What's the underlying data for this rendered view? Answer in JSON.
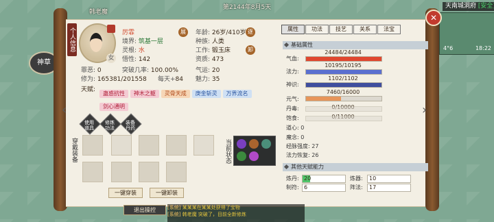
{
  "top": {
    "character_name": "韩老魔",
    "date": "第2144年8月5天",
    "location": "天南城洞府",
    "safe_label": "[安全]",
    "minimap_left": "4°6",
    "minimap_right": "18:22"
  },
  "side_button": "神草",
  "close_label": "✕",
  "left_tab": "个人信息",
  "profile": {
    "name": "厉霏",
    "realm_label": "境界:",
    "realm": "筑基一层",
    "root_label": "灵根:",
    "root": "水",
    "insight_label": "悟性:",
    "insight": "142",
    "age_label": "年龄:",
    "age": "26岁/410岁",
    "race_label": "种族:",
    "race": "人类",
    "job_label": "工作:",
    "job": "锻玉床",
    "aptitude_label": "资质:",
    "aptitude": "473",
    "luck_label": "气运:",
    "luck": "20",
    "charm_label": "魅力:",
    "charm": "35",
    "sin_label": "罪恶:",
    "sin": "0",
    "break_label": "突破几率:",
    "break": "100.00%",
    "cultivation_label": "修为:",
    "cultivation": "165381/201558",
    "daily_label": "每天+",
    "daily": "84",
    "talent_label": "天赋:",
    "zhan": "展",
    "chou": "逐",
    "ju": "卸",
    "gender": "女"
  },
  "talents": [
    {
      "label": "蛊惑抗性",
      "style": "pink"
    },
    {
      "label": "神木之躯",
      "style": "pink"
    },
    {
      "label": "灵骨天成",
      "style": "orange"
    },
    {
      "label": "庚金斩灵",
      "style": "blue"
    },
    {
      "label": "万界流名",
      "style": "blue"
    },
    {
      "label": "剑心通明",
      "style": "pink"
    }
  ],
  "action_buttons": [
    "使用道具",
    "修炼功法",
    "装备丹药"
  ],
  "equip_tab": "穿戴装备",
  "status_tab": "当前状态",
  "buttons": {
    "equip_all": "一键穿装",
    "unequip_all": "一键卸装",
    "exit": "退出操控"
  },
  "right_tabs": [
    "属性",
    "功法",
    "技艺",
    "关系",
    "法宝"
  ],
  "basic_section": "基础属性",
  "stats": {
    "hp_label": "气血:",
    "hp_value": "24484/24484",
    "hp_fraction": 1.0,
    "mp_label": "法力:",
    "mp_value": "10195/10195",
    "mp_fraction": 1.0,
    "sense_label": "神识:",
    "sense_value": "1102/1102",
    "sense_fraction": 1.0,
    "yuan_label": "元气:",
    "yuan_value": "7460/16000",
    "yuan_fraction": 0.466,
    "pill_label": "丹毒:",
    "pill_value": "0/10000",
    "pill_fraction": 0.0,
    "hunger_label": "饱食:",
    "hunger_value": "0/11000",
    "hunger_fraction": 0.0,
    "daoxin_label": "道心:",
    "daoxin": "0",
    "mo_label": "魔念:",
    "mo": "0",
    "meridian_label": "经脉强度:",
    "meridian": "27",
    "recovery_label": "法力恢复:",
    "recovery": "26"
  },
  "other_section": "其他天赋能力",
  "skills": [
    {
      "label": "炼丹:",
      "value": "20",
      "fraction": 0.18
    },
    {
      "label": "炼器:",
      "value": "10",
      "fraction": 0.0
    },
    {
      "label": "制符:",
      "value": "6",
      "fraction": 0.0
    },
    {
      "label": "阵法:",
      "value": "17",
      "fraction": 0.0
    }
  ],
  "chat": {
    "line1_tag": "[系统]",
    "line1_text": "某某某在某某处获得了宝物",
    "line2_tag": "[系统]",
    "line2_text": "韩老魔 突破了，目前全新修炼"
  },
  "colors": {
    "hp": "#e0472f",
    "mp": "#5a6fd0",
    "sense": "#3f4e9e",
    "yuan": "#e7955a"
  }
}
